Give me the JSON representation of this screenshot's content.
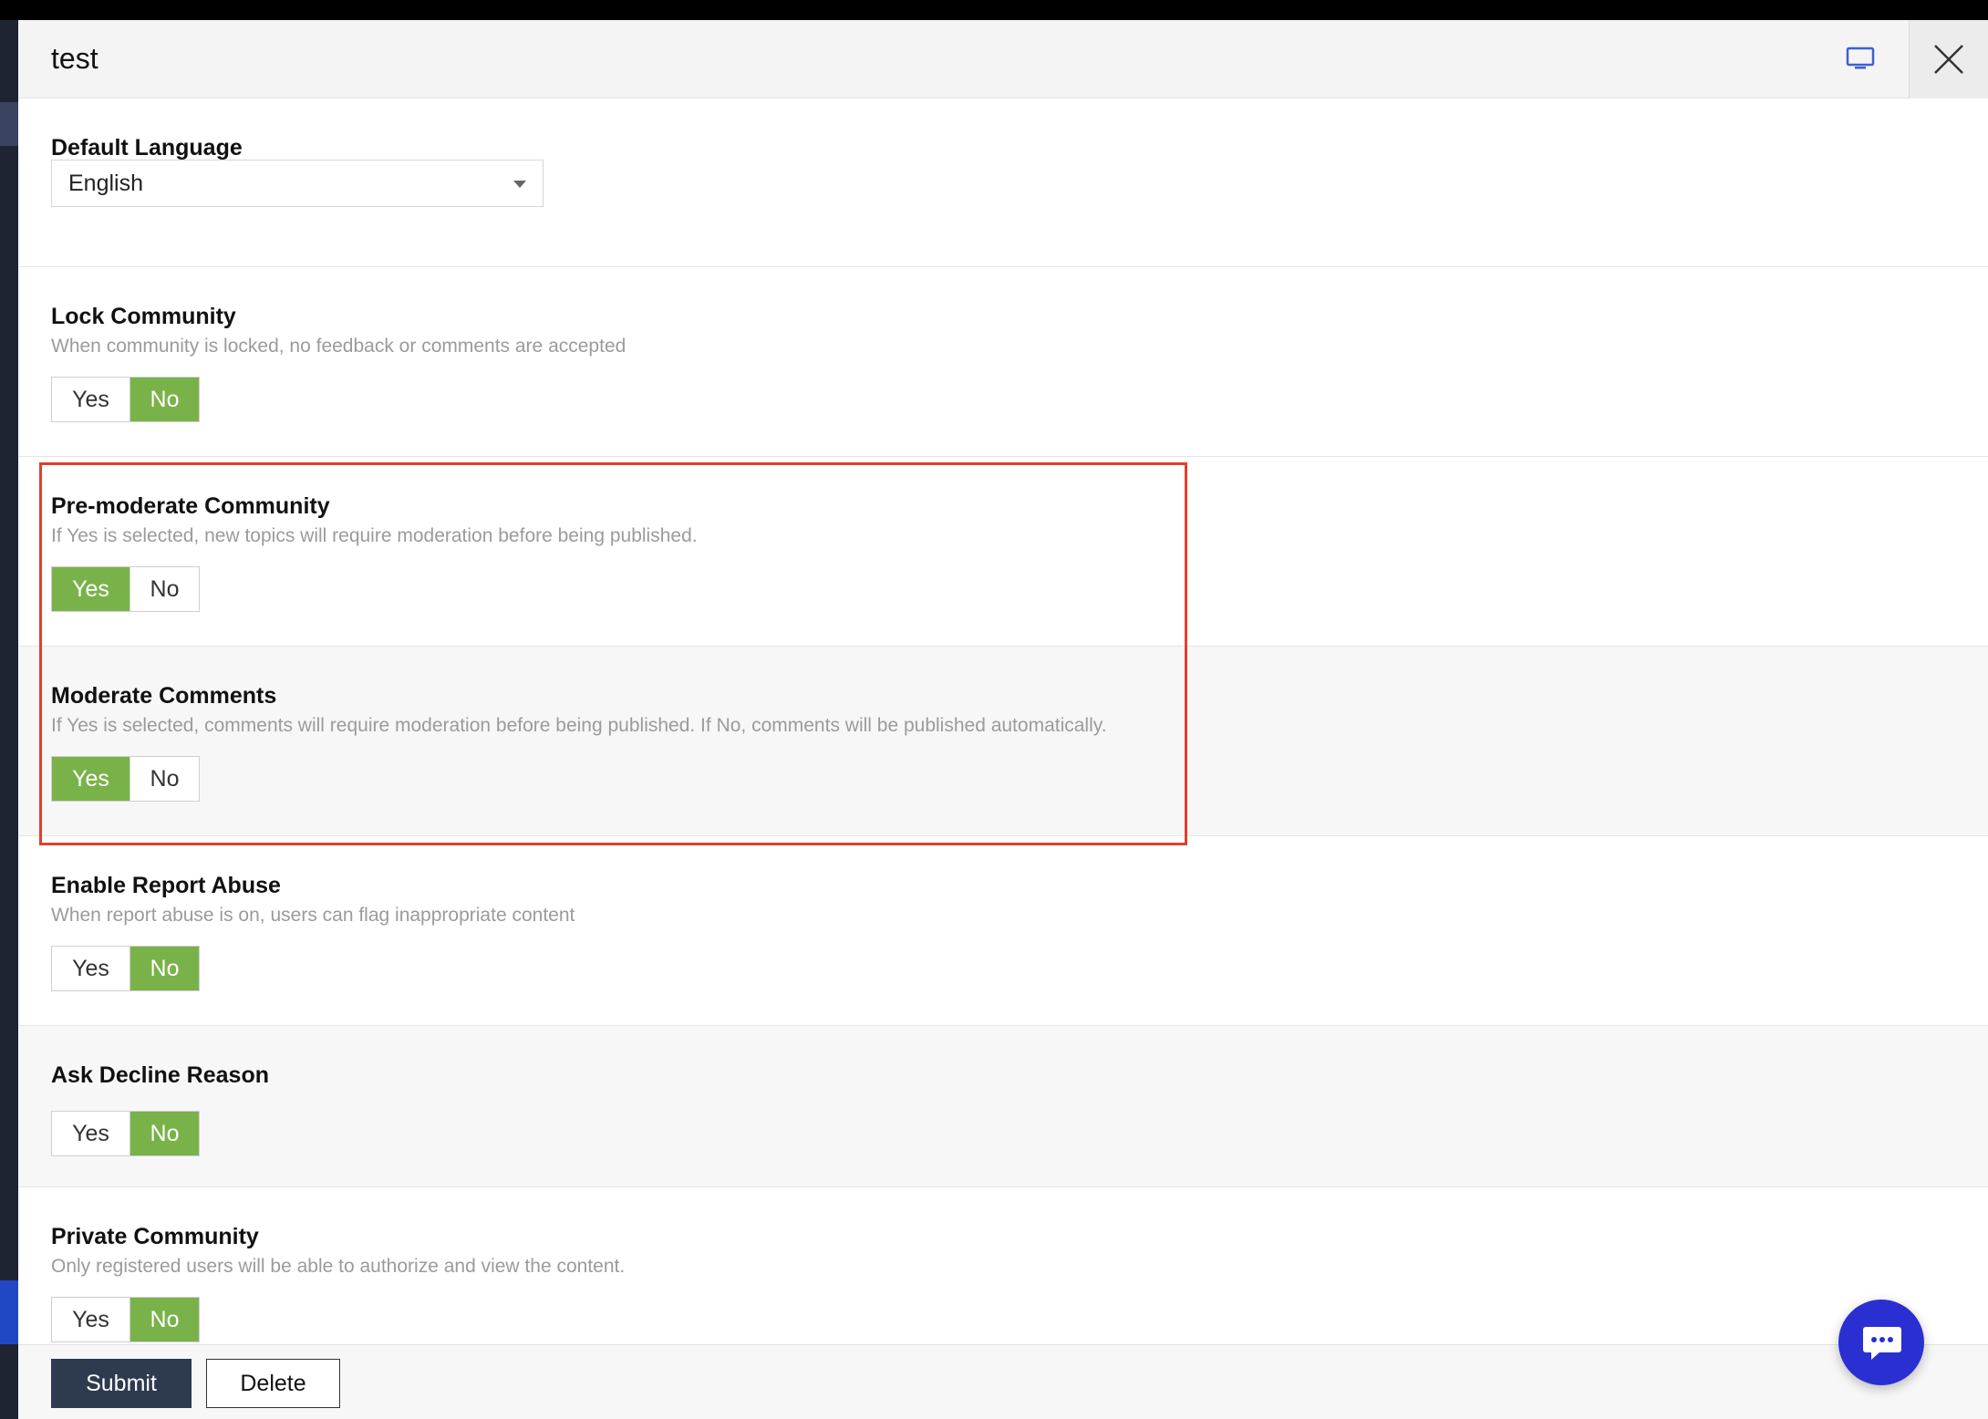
{
  "window": {
    "title": "test"
  },
  "default_language": {
    "label": "Default Language",
    "selected": "English"
  },
  "settings": [
    {
      "key": "lock_community",
      "label": "Lock Community",
      "description": "When community is locked, no feedback or comments are accepted",
      "yes_label": "Yes",
      "no_label": "No",
      "value": "No"
    },
    {
      "key": "pre_moderate_community",
      "label": "Pre-moderate Community",
      "description": "If Yes is selected, new topics will require moderation before being published.",
      "yes_label": "Yes",
      "no_label": "No",
      "value": "Yes"
    },
    {
      "key": "moderate_comments",
      "label": "Moderate Comments",
      "description": "If Yes is selected, comments will require moderation before being published. If No, comments will be published automatically.",
      "yes_label": "Yes",
      "no_label": "No",
      "value": "Yes"
    },
    {
      "key": "enable_report_abuse",
      "label": "Enable Report Abuse",
      "description": "When report abuse is on, users can flag inappropriate content",
      "yes_label": "Yes",
      "no_label": "No",
      "value": "No"
    },
    {
      "key": "ask_decline_reason",
      "label": "Ask Decline Reason",
      "description": "",
      "yes_label": "Yes",
      "no_label": "No",
      "value": "No"
    },
    {
      "key": "private_community",
      "label": "Private Community",
      "description": "Only registered users will be able to authorize and view the content.",
      "yes_label": "Yes",
      "no_label": "No",
      "value": "No"
    }
  ],
  "footer": {
    "submit_label": "Submit",
    "delete_label": "Delete"
  },
  "colors": {
    "active_green": "#7ab24a",
    "highlight_red": "#e0402c",
    "submit_bg": "#2e3a4d",
    "chat_fab_bg": "#2a2fd1"
  },
  "icons": {
    "header_monitor": "monitor-icon",
    "header_close": "close-icon",
    "select_caret": "caret-down-icon",
    "chat": "chat-bubble-icon"
  }
}
